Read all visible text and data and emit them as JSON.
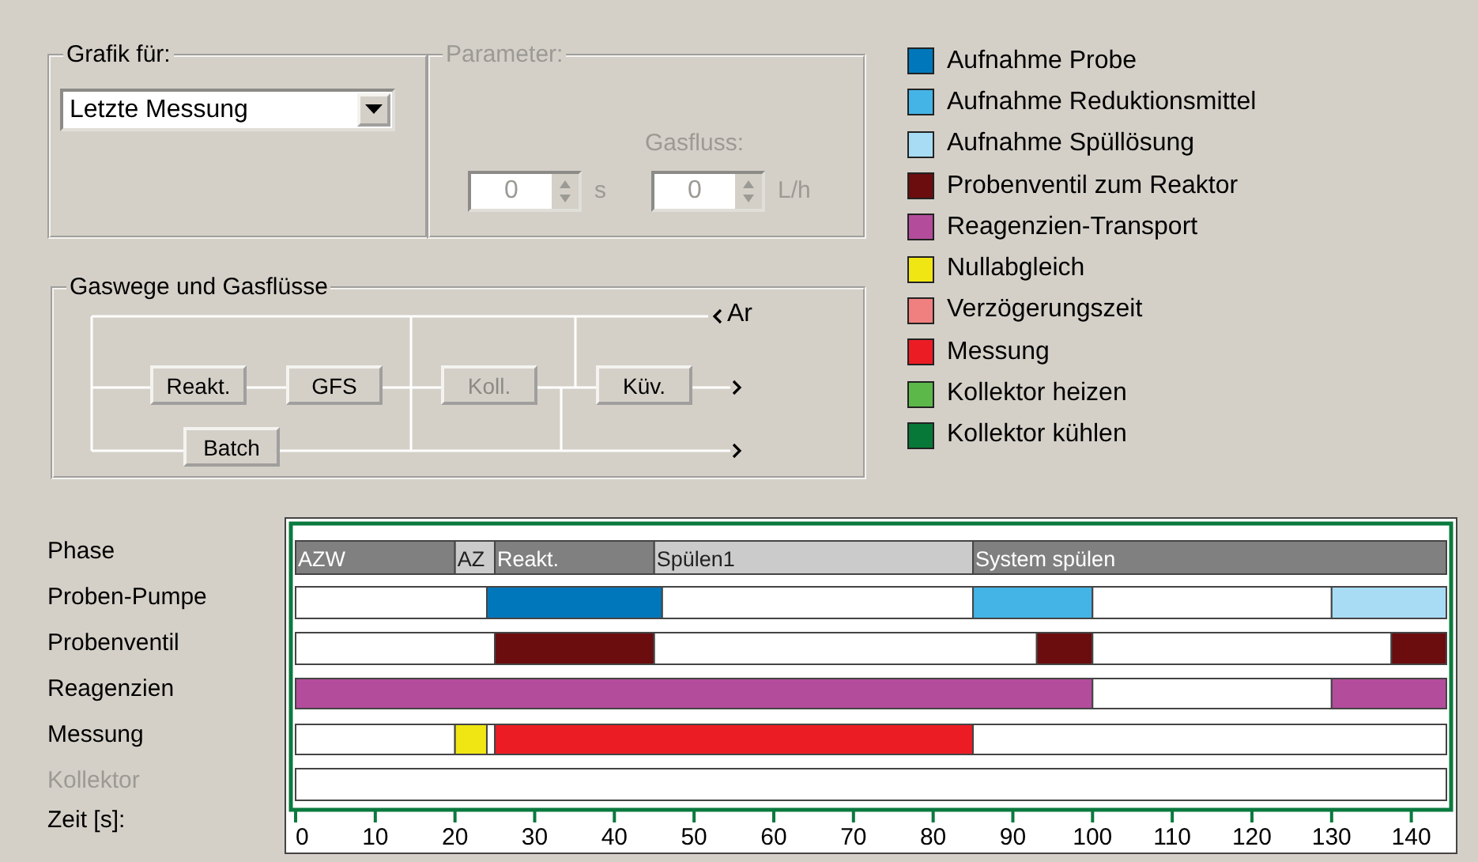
{
  "graph_for": {
    "title": "Grafik für:",
    "dropdown": {
      "value": "Letzte Messung"
    }
  },
  "parameters": {
    "title": "Parameter:",
    "disabled": true,
    "fields": [
      {
        "value": "0",
        "unit": "s"
      },
      {
        "label": "Gasfluss:",
        "value": "0",
        "unit": "L/h"
      }
    ]
  },
  "gas_paths": {
    "title": "Gaswege und Gasflüsse",
    "inlet_label": "Ar",
    "buttons": [
      {
        "label": "Reakt.",
        "disabled": false
      },
      {
        "label": "GFS",
        "disabled": false
      },
      {
        "label": "Koll.",
        "disabled": true
      },
      {
        "label": "Küv.",
        "disabled": false
      },
      {
        "label": "Batch",
        "disabled": false
      }
    ]
  },
  "legend": [
    {
      "label": "Aufnahme Probe",
      "color": "#0077bb"
    },
    {
      "label": "Aufnahme Reduktionsmittel",
      "color": "#44b4e6"
    },
    {
      "label": "Aufnahme Spüllösung",
      "color": "#a8dcf4"
    },
    {
      "label": "Probenventil zum Reaktor",
      "color": "#6b0c0e"
    },
    {
      "label": "Reagenzien-Transport",
      "color": "#b44c9c"
    },
    {
      "label": "Nullabgleich",
      "color": "#f0e614"
    },
    {
      "label": "Verzögerungszeit",
      "color": "#f08080"
    },
    {
      "label": "Messung",
      "color": "#ec1c24"
    },
    {
      "label": "Kollektor heizen",
      "color": "#5cb848"
    },
    {
      "label": "Kollektor kühlen",
      "color": "#087838"
    }
  ],
  "timeline_rows": [
    {
      "disabled": false
    },
    {
      "disabled": false
    },
    {
      "disabled": false
    },
    {
      "disabled": false
    },
    {
      "disabled": false
    },
    {
      "disabled": true
    }
  ],
  "chart_data": {
    "type": "bar",
    "orientation": "horizontal",
    "stacked": true,
    "xlabel": "Zeit [s]:",
    "categories": [
      "Phase",
      "Proben-Pumpe",
      "Probenventil",
      "Reagenzien",
      "Messung",
      "Kollektor"
    ],
    "xlim": [
      0,
      144.4
    ],
    "xticks": [
      {
        "value": 0,
        "label": "0"
      },
      10,
      20,
      30,
      40,
      50,
      60,
      70,
      80,
      90,
      100,
      110,
      120,
      130,
      140
    ],
    "annotations": [
      {
        "text": "AZW",
        "x": 0,
        "y": "Phase"
      },
      {
        "text": "AZ",
        "x": 20,
        "y": "Phase"
      },
      {
        "text": "Reakt.",
        "x": 25,
        "y": "Phase"
      },
      {
        "text": "Spülen1",
        "x": 45,
        "y": "Phase"
      },
      {
        "text": "System spülen",
        "x": 85,
        "y": "Phase"
      }
    ],
    "series": [
      {
        "color": "#808080",
        "values": [
          20,
          null,
          null,
          null,
          null,
          null
        ]
      },
      {
        "color": "#cbcbcb",
        "values": [
          5,
          null,
          null,
          null,
          null,
          null
        ]
      },
      {
        "color": "#808080",
        "values": [
          20,
          null,
          null,
          null,
          null,
          null
        ]
      },
      {
        "color": "#cbcbcb",
        "values": [
          40,
          null,
          null,
          null,
          null,
          null
        ]
      },
      {
        "color": "#808080",
        "values": [
          59.4,
          null,
          null,
          null,
          null,
          null
        ]
      },
      {
        "color": "#ffffff",
        "values": [
          null,
          24,
          null,
          null,
          null,
          null
        ]
      },
      {
        "color": "#0077bb",
        "values": [
          null,
          22,
          null,
          null,
          null,
          null
        ]
      },
      {
        "color": "#ffffff",
        "values": [
          null,
          39,
          null,
          null,
          null,
          null
        ]
      },
      {
        "color": "#44b4e6",
        "values": [
          null,
          15,
          null,
          null,
          null,
          null
        ]
      },
      {
        "color": "#ffffff",
        "values": [
          null,
          30,
          null,
          null,
          null,
          null
        ]
      },
      {
        "color": "#a8dcf4",
        "values": [
          null,
          14.4,
          null,
          null,
          null,
          null
        ]
      },
      {
        "color": "#ffffff",
        "values": [
          null,
          null,
          25,
          null,
          null,
          null
        ]
      },
      {
        "color": "#6b0c0e",
        "values": [
          null,
          null,
          20,
          null,
          null,
          null
        ]
      },
      {
        "color": "#ffffff",
        "values": [
          null,
          null,
          48,
          null,
          null,
          null
        ]
      },
      {
        "color": "#6b0c0e",
        "values": [
          null,
          null,
          7,
          null,
          null,
          null
        ]
      },
      {
        "color": "#ffffff",
        "values": [
          null,
          null,
          37.5,
          null,
          null,
          null
        ]
      },
      {
        "color": "#6b0c0e",
        "values": [
          null,
          null,
          6.9,
          null,
          null,
          null
        ]
      },
      {
        "color": "#b44c9c",
        "values": [
          null,
          null,
          null,
          100,
          null,
          null
        ]
      },
      {
        "color": "#ffffff",
        "values": [
          null,
          null,
          null,
          30,
          null,
          null
        ]
      },
      {
        "color": "#b44c9c",
        "values": [
          null,
          null,
          null,
          14.4,
          null,
          null
        ]
      },
      {
        "color": "#ffffff",
        "values": [
          null,
          null,
          null,
          null,
          20,
          null
        ]
      },
      {
        "color": "#f0e614",
        "values": [
          null,
          null,
          null,
          null,
          4,
          null
        ]
      },
      {
        "color": "#ffffff",
        "values": [
          null,
          null,
          null,
          null,
          1,
          null
        ]
      },
      {
        "color": "#ec1c24",
        "values": [
          null,
          null,
          null,
          null,
          60,
          null
        ]
      },
      {
        "color": "#ffffff",
        "values": [
          null,
          null,
          null,
          null,
          59.4,
          null
        ]
      },
      {
        "color": "#ffffff",
        "values": [
          null,
          null,
          null,
          null,
          null,
          144.4
        ]
      }
    ]
  }
}
